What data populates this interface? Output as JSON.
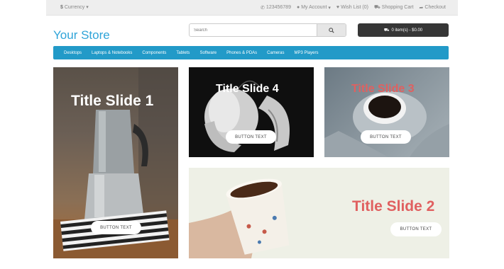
{
  "topbar": {
    "currency": "Currency",
    "phone": "123456789",
    "my_account": "My Account",
    "wish_list": "Wish List (0)",
    "shopping_cart": "Shopping Cart",
    "checkout": "Checkout"
  },
  "header": {
    "logo": "Your Store",
    "search_placeholder": "Search",
    "cart_label": "0 item(s) - $0.00"
  },
  "nav": {
    "items": [
      "Desktops",
      "Laptops & Notebooks",
      "Components",
      "Tablets",
      "Software",
      "Phones & PDAs",
      "Cameras",
      "MP3 Players"
    ]
  },
  "slides": [
    {
      "title": "Title Slide 1",
      "button": "BUTTON TEXT"
    },
    {
      "title": "Title Slide 4",
      "button": "BUTTON TEXT"
    },
    {
      "title": "Title Slide 3",
      "button": "BUTTON TEXT"
    },
    {
      "title": "Title Slide 2",
      "button": "BUTTON TEXT"
    }
  ],
  "colors": {
    "brand": "#2fa4d8",
    "nav": "#229ac8",
    "cart": "#363636",
    "title_light": "#ffffff",
    "title_accent": "#e06060"
  }
}
